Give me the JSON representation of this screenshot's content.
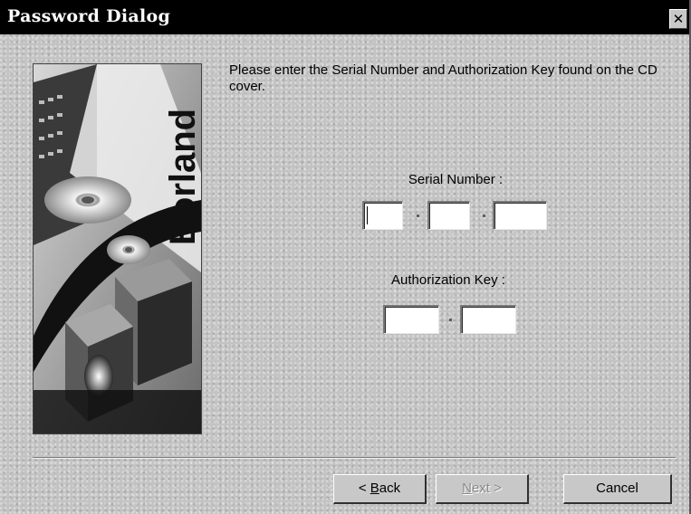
{
  "window": {
    "title": "Password Dialog",
    "close_symbol": "✕",
    "close_icon": "close-icon"
  },
  "banner": {
    "brand_text": "Borland",
    "image": "borland-cd-artwork"
  },
  "instructions": {
    "text": "Please enter the Serial Number and Authorization Key found on the CD cover."
  },
  "serial_number": {
    "label": "Serial Number :",
    "fields": [
      "",
      "",
      ""
    ]
  },
  "authorization_key": {
    "label": "Authorization Key :",
    "fields": [
      "",
      ""
    ]
  },
  "buttons": {
    "back_prefix": "< ",
    "back_mnemonic": "B",
    "back_rest": "ack",
    "next_mnemonic": "N",
    "next_rest": "ext >",
    "cancel_label": "Cancel"
  },
  "colors": {
    "title_bar": "#000000",
    "dialog_face": "#c3c3c3",
    "disabled_text": "#8a8a8a"
  }
}
